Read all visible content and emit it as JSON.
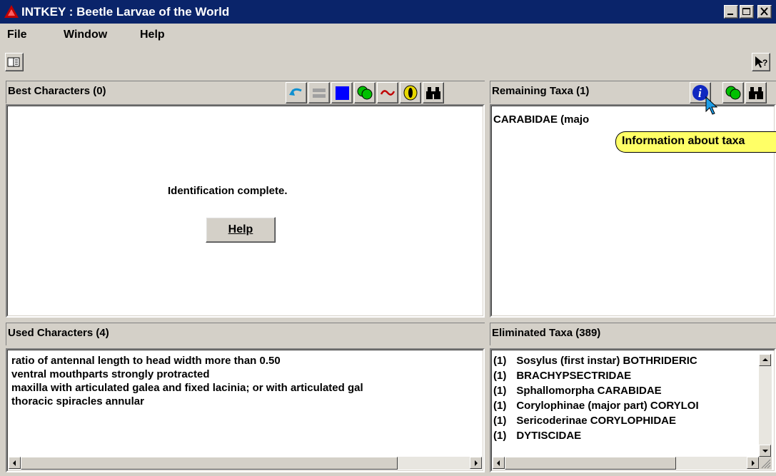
{
  "window": {
    "title": "INTKEY : Beetle Larvae of the World"
  },
  "menu": {
    "file": "File",
    "window": "Window",
    "help": "Help"
  },
  "best_characters": {
    "title": "Best Characters (0)",
    "message": "Identification complete.",
    "help_button": "Help"
  },
  "remaining_taxa": {
    "title": "Remaining Taxa (1)",
    "items": [
      "CARABIDAE (majo"
    ],
    "tooltip": "Information about taxa"
  },
  "used_characters": {
    "title": "Used Characters (4)",
    "items": [
      "ratio of antennal length to head width more than 0.50",
      "ventral mouthparts strongly protracted",
      "maxilla with articulated galea and fixed lacinia; or with articulated gal",
      "thoracic spiracles annular"
    ]
  },
  "eliminated_taxa": {
    "title": "Eliminated Taxa (389)",
    "items": [
      {
        "count": "(1)",
        "name": "Sosylus (first instar) BOTHRIDERIC"
      },
      {
        "count": "(1)",
        "name": "BRACHYPSECTRIDAE"
      },
      {
        "count": "(1)",
        "name": "Sphallomorpha CARABIDAE"
      },
      {
        "count": "(1)",
        "name": "Corylophinae (major part) CORYLOI"
      },
      {
        "count": "(1)",
        "name": "Sericoderinae CORYLOPHIDAE"
      },
      {
        "count": "(1)",
        "name": "DYTISCIDAE"
      }
    ]
  },
  "icons": {
    "app": "intkey-logo-icon",
    "toolbar": [
      "book-icon",
      "context-help-icon"
    ],
    "best_characters_tools": [
      "undo-icon",
      "separate-icon",
      "diagnose-icon",
      "differences-icon",
      "similarities-icon",
      "taxon-info-icon",
      "find-icon"
    ],
    "remaining_taxa_tools": [
      "information-icon",
      "differences-icon",
      "find-icon"
    ]
  },
  "colors": {
    "titlebar": "#0a246a",
    "tooltip": "#ffff66",
    "face": "#d4d0c8"
  }
}
